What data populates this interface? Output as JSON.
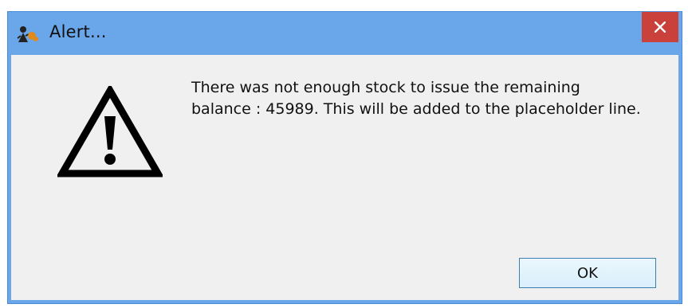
{
  "window": {
    "title": "Alert...",
    "app_icon": "app-logo-icon",
    "close_icon": "close-icon",
    "colors": {
      "titlebar": "#6aa6ea",
      "close_button": "#c9413a",
      "client_background": "#f0f0f0"
    }
  },
  "dialog": {
    "icon": "warning-icon",
    "message_lines": [
      "There was not enough stock to issue the remaining",
      "balance : 45989. This will be added to the placeholder line."
    ],
    "ok_label": "OK"
  }
}
